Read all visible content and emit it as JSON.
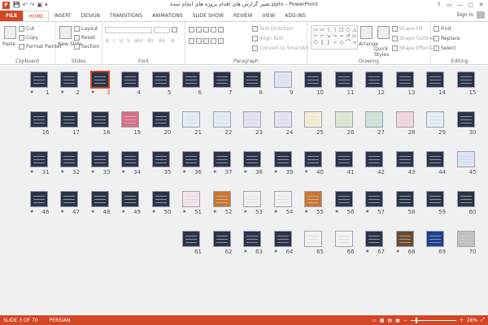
{
  "titlebar": {
    "app_icon": "P",
    "qat": [
      "💾",
      "↶",
      "↷",
      "▣",
      "▾"
    ],
    "title": "تغییر گزارش های اقدام پروژه های انجام شده.pptx - PowerPoint",
    "controls": [
      "?",
      "▭",
      "—",
      "▢",
      "✕"
    ]
  },
  "tabs": [
    "FILE",
    "HOME",
    "INSERT",
    "DESIGN",
    "TRANSITIONS",
    "ANIMATIONS",
    "SLIDE SHOW",
    "REVIEW",
    "VIEW",
    "ADD-INS"
  ],
  "signin": "Sign in",
  "ribbon": {
    "clipboard": {
      "label": "Clipboard",
      "paste": "Paste",
      "cut": "Cut",
      "copy": "Copy",
      "format_painter": "Format Painter"
    },
    "slides": {
      "label": "Slides",
      "new_slide": "New Slide",
      "layout": "Layout",
      "reset": "Reset",
      "section": "Section"
    },
    "font": {
      "label": "Font",
      "bold": "B",
      "italic": "I",
      "underline": "U",
      "strike": "S",
      "shadow": "abc",
      "spacing": "AV",
      "case": "Aa",
      "color": "A"
    },
    "paragraph": {
      "label": "Paragraph",
      "text_direction": "Text Direction",
      "align_text": "Align Text",
      "convert": "Convert to SmartArt"
    },
    "drawing": {
      "label": "Drawing",
      "arrange": "Arrange",
      "quick_styles": "Quick Styles",
      "shape_fill": "Shape Fill",
      "shape_outline": "Shape Outline",
      "shape_effects": "Shape Effects",
      "shapes": [
        "▭",
        "▭",
        "\\",
        "\\",
        "□",
        "○",
        "△",
        "⌐",
        "⌐",
        "↘",
        "⇨",
        "⇦",
        "↺",
        "▷",
        "⬠",
        "{",
        "}",
        "☆",
        "◇",
        "⌒",
        "▿"
      ]
    },
    "editing": {
      "label": "Editing",
      "find": "Find",
      "replace": "Replace",
      "select": "Select"
    }
  },
  "slides": {
    "selected": "3",
    "rows": [
      [
        {
          "n": "15",
          "s": false,
          "c": "#2b3447"
        },
        {
          "n": "14",
          "s": false,
          "c": "#2b3447"
        },
        {
          "n": "13",
          "s": false,
          "c": "#2b3447"
        },
        {
          "n": "12",
          "s": false,
          "c": "#2b3447"
        },
        {
          "n": "11",
          "s": false,
          "c": "#2b3447"
        },
        {
          "n": "10",
          "s": false,
          "c": "#2b3447"
        },
        {
          "n": "9",
          "s": false,
          "c": "#dfe6f2"
        },
        {
          "n": "8",
          "s": false,
          "c": "#2b3447"
        },
        {
          "n": "7",
          "s": false,
          "c": "#2b3447"
        },
        {
          "n": "6",
          "s": false,
          "c": "#2b3447"
        },
        {
          "n": "5",
          "s": false,
          "c": "#2b3447"
        },
        {
          "n": "4",
          "s": false,
          "c": "#2b3447"
        },
        {
          "n": "3",
          "s": true,
          "c": "#2b3447"
        },
        {
          "n": "2",
          "s": true,
          "c": "#2b3447"
        },
        {
          "n": "1",
          "s": true,
          "c": "#2b3447"
        }
      ],
      [
        {
          "n": "30",
          "s": false,
          "c": "#2b3447"
        },
        {
          "n": "29",
          "s": false,
          "c": "#e8ecf4"
        },
        {
          "n": "28",
          "s": false,
          "c": "#f2d6de"
        },
        {
          "n": "27",
          "s": false,
          "c": "#cfe3d3"
        },
        {
          "n": "26",
          "s": false,
          "c": "#dde8cf"
        },
        {
          "n": "25",
          "s": false,
          "c": "#f4efd4"
        },
        {
          "n": "24",
          "s": false,
          "c": "#e6e2f3"
        },
        {
          "n": "23",
          "s": false,
          "c": "#e6e2f3"
        },
        {
          "n": "22",
          "s": false,
          "c": "#e5e9f0"
        },
        {
          "n": "21",
          "s": false,
          "c": "#e7ecf2"
        },
        {
          "n": "20",
          "s": false,
          "c": "#2b3447"
        },
        {
          "n": "19",
          "s": false,
          "c": "#d96e84"
        },
        {
          "n": "18",
          "s": false,
          "c": "#2b3447"
        },
        {
          "n": "17",
          "s": false,
          "c": "#2b3447"
        },
        {
          "n": "16",
          "s": false,
          "c": "#2b3447"
        }
      ],
      [
        {
          "n": "45",
          "s": false,
          "c": "#dbe5f3"
        },
        {
          "n": "44",
          "s": false,
          "c": "#2b3447"
        },
        {
          "n": "43",
          "s": false,
          "c": "#2b3447"
        },
        {
          "n": "42",
          "s": false,
          "c": "#2b3447"
        },
        {
          "n": "41",
          "s": false,
          "c": "#2b3447"
        },
        {
          "n": "40",
          "s": true,
          "c": "#2b3447"
        },
        {
          "n": "39",
          "s": true,
          "c": "#2b3447"
        },
        {
          "n": "38",
          "s": true,
          "c": "#2b3447"
        },
        {
          "n": "37",
          "s": true,
          "c": "#2b3447"
        },
        {
          "n": "36",
          "s": true,
          "c": "#2b3447"
        },
        {
          "n": "35",
          "s": false,
          "c": "#2b3447"
        },
        {
          "n": "34",
          "s": true,
          "c": "#2b3447"
        },
        {
          "n": "33",
          "s": true,
          "c": "#2b3447"
        },
        {
          "n": "32",
          "s": true,
          "c": "#2b3447"
        },
        {
          "n": "31",
          "s": true,
          "c": "#2b3447"
        }
      ],
      [
        {
          "n": "60",
          "s": false,
          "c": "#2b3447"
        },
        {
          "n": "59",
          "s": false,
          "c": "#2b3447"
        },
        {
          "n": "58",
          "s": false,
          "c": "#2b3447"
        },
        {
          "n": "57",
          "s": true,
          "c": "#2b3447"
        },
        {
          "n": "56",
          "s": true,
          "c": "#2b3447"
        },
        {
          "n": "55",
          "s": true,
          "c": "#c8772f"
        },
        {
          "n": "54",
          "s": true,
          "c": "#f0f0f0"
        },
        {
          "n": "53",
          "s": true,
          "c": "#f0f0f0"
        },
        {
          "n": "52",
          "s": true,
          "c": "#c8772f"
        },
        {
          "n": "51",
          "s": true,
          "c": "#f3e4ea"
        },
        {
          "n": "50",
          "s": true,
          "c": "#2b3447"
        },
        {
          "n": "49",
          "s": true,
          "c": "#2b3447"
        },
        {
          "n": "48",
          "s": true,
          "c": "#2b3447"
        },
        {
          "n": "47",
          "s": true,
          "c": "#2b3447"
        },
        {
          "n": "46",
          "s": true,
          "c": "#2b3447"
        }
      ],
      [
        {
          "n": "70",
          "s": false,
          "c": "#c4c1bb"
        },
        {
          "n": "69",
          "s": false,
          "c": "#1f3f8a"
        },
        {
          "n": "68",
          "s": true,
          "c": "#6b4a2a"
        },
        {
          "n": "67",
          "s": true,
          "c": "#2b3447"
        },
        {
          "n": "66",
          "s": false,
          "c": "#f2f2f2"
        },
        {
          "n": "65",
          "s": false,
          "c": "#f2f2f2"
        },
        {
          "n": "64",
          "s": true,
          "c": "#2b3447"
        },
        {
          "n": "63",
          "s": true,
          "c": "#2b3447"
        },
        {
          "n": "62",
          "s": false,
          "c": "#2b3447"
        },
        {
          "n": "61",
          "s": false,
          "c": "#2b3447"
        }
      ]
    ]
  },
  "status": {
    "slide": "SLIDE 3 OF 70",
    "language": "PERSIAN",
    "zoom": "28%"
  },
  "colors": {
    "accent": "#d24726",
    "slide_dark": "#2b3447"
  }
}
